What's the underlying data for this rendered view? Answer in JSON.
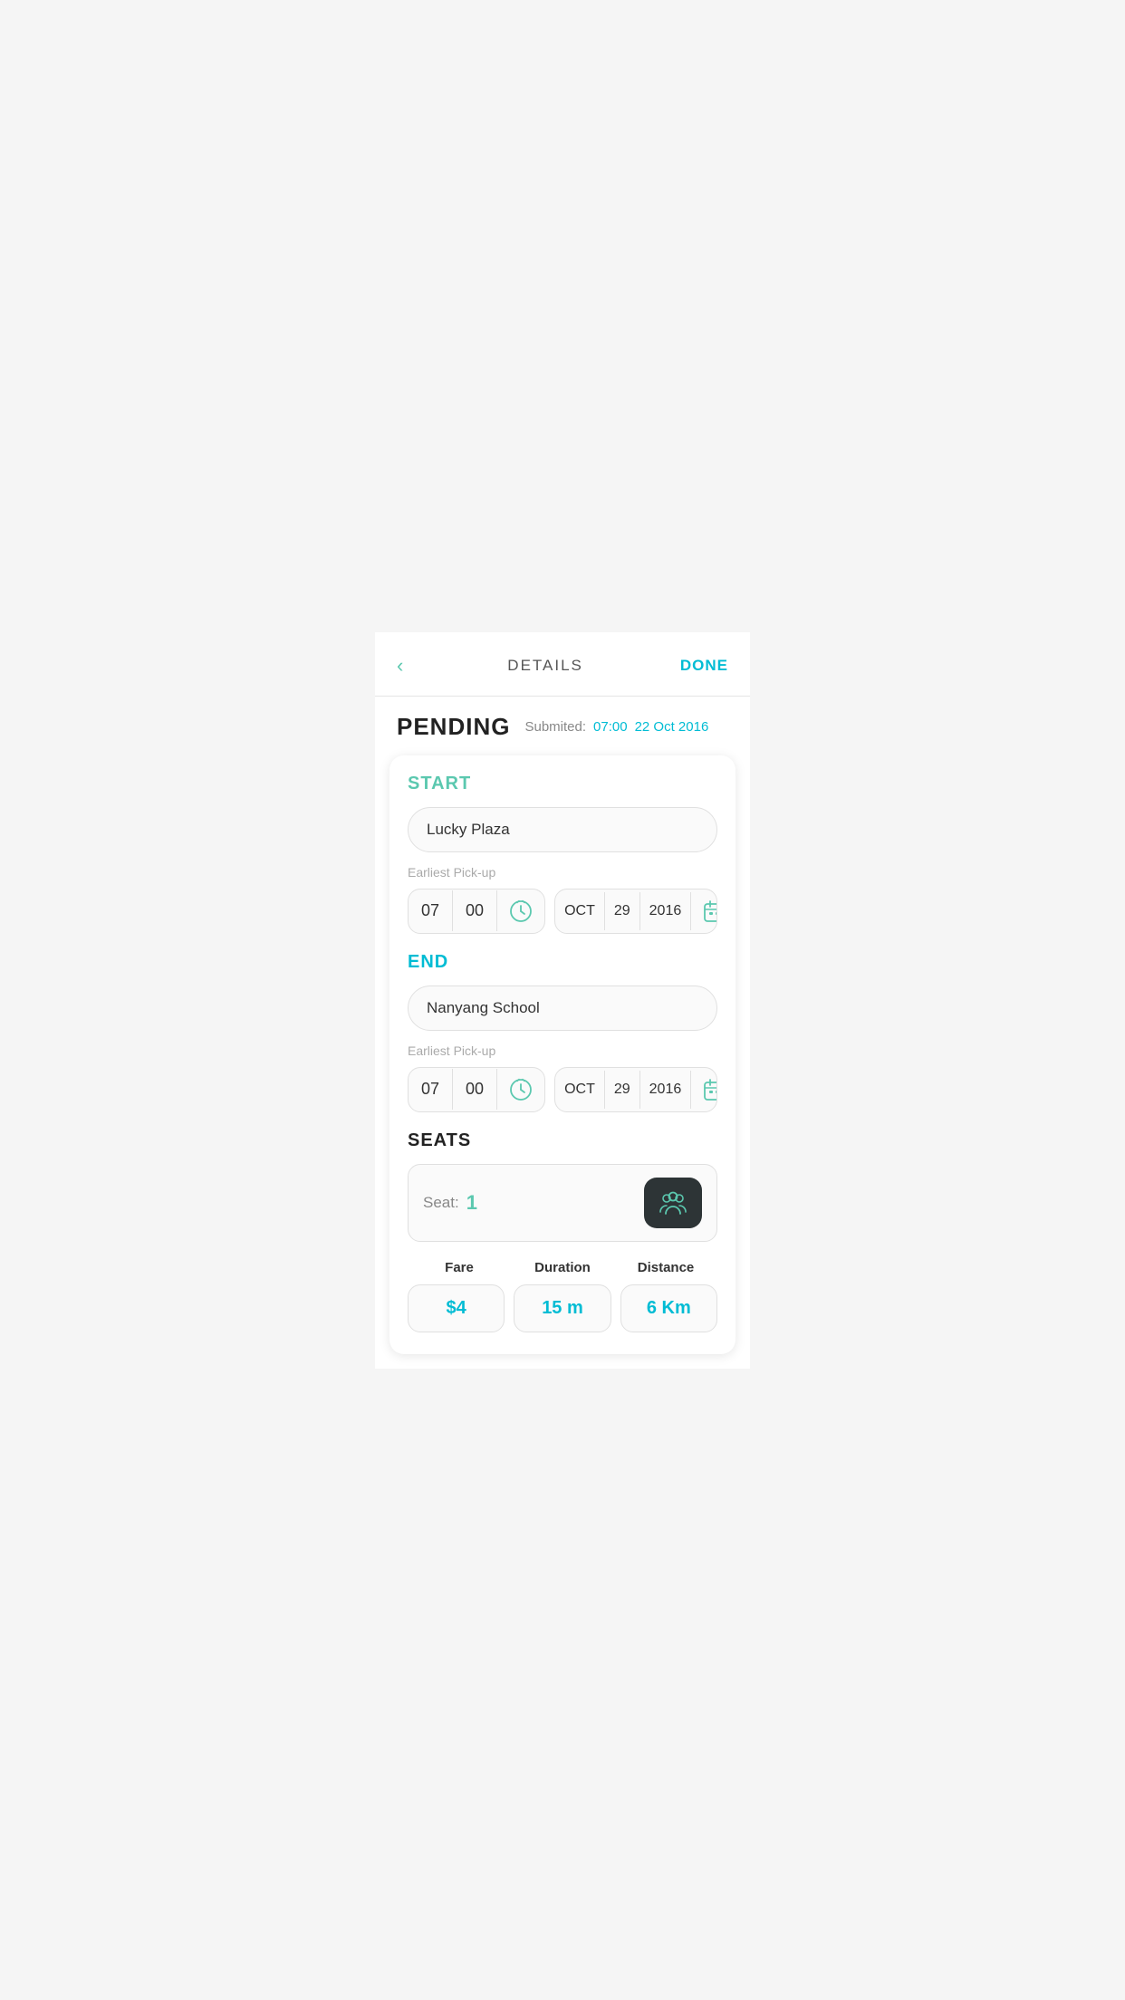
{
  "header": {
    "back_label": "‹",
    "title": "DETAILS",
    "done_label": "DONE"
  },
  "status": {
    "label": "PENDING",
    "submitted_text": "Submited:",
    "submitted_time": "07:00",
    "submitted_date": "22 Oct 2016"
  },
  "start": {
    "section_title": "START",
    "location": "Lucky Plaza",
    "pickup_label": "Earliest Pick-up",
    "time": {
      "hour": "07",
      "minute": "00"
    },
    "date": {
      "month": "OCT",
      "day": "29",
      "year": "2016"
    }
  },
  "end": {
    "section_title": "END",
    "location": "Nanyang School",
    "pickup_label": "Earliest Pick-up",
    "time": {
      "hour": "07",
      "minute": "00"
    },
    "date": {
      "month": "OCT",
      "day": "29",
      "year": "2016"
    }
  },
  "seats": {
    "section_title": "SEATS",
    "label": "Seat:",
    "count": "1"
  },
  "fare": {
    "title": "Fare",
    "value": "$4"
  },
  "duration": {
    "title": "Duration",
    "value": "15 m"
  },
  "distance": {
    "title": "Distance",
    "value": "6 Km"
  }
}
